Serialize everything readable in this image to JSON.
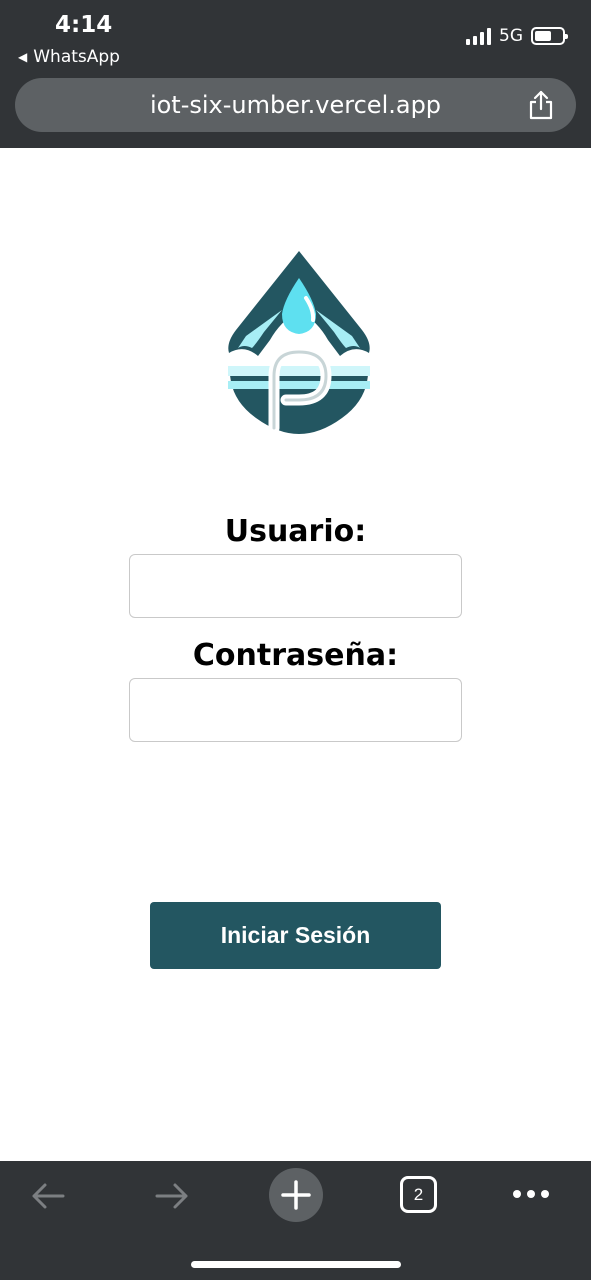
{
  "status_bar": {
    "time": "4:14",
    "back_app": "WhatsApp",
    "network": "5G",
    "battery_level": 0.6
  },
  "browser": {
    "url": "iot-six-umber.vercel.app",
    "tabs_count": "2",
    "icons": [
      "share-icon",
      "back-arrow-icon",
      "forward-arrow-icon",
      "new-tab-plus-icon",
      "tabs-icon",
      "more-icon"
    ]
  },
  "colors": {
    "brand": "#235661",
    "accent": "#5ee0f0",
    "chrome": "#313437"
  },
  "form": {
    "user_label": "Usuario:",
    "user_value": "",
    "password_label": "Contraseña:",
    "password_value": "",
    "submit_label": "Iniciar Sesión"
  }
}
